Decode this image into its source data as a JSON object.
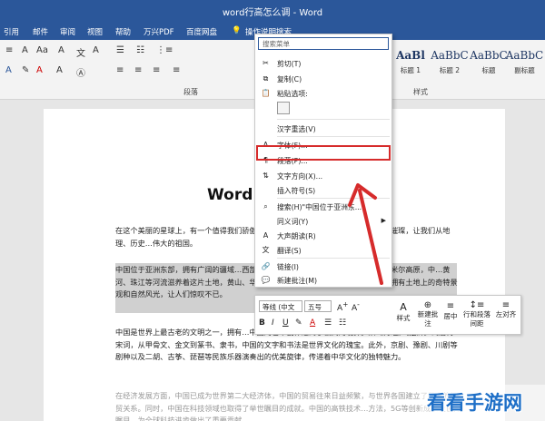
{
  "window": {
    "title": "word行高怎么调 - Word"
  },
  "menu": [
    "引用",
    "邮件",
    "审阅",
    "视图",
    "帮助",
    "万兴PDF",
    "百度网盘",
    "操作说明搜索"
  ],
  "ribbon": {
    "paragraph_group": "段落",
    "styles_group": "样式",
    "styles": [
      {
        "preview": "AaBl",
        "label": "标题 1"
      },
      {
        "preview": "AaBbC",
        "label": "标题 2"
      },
      {
        "preview": "AaBbC",
        "label": "标题"
      },
      {
        "preview": "AaBbC",
        "label": "副标题"
      }
    ]
  },
  "context_menu": {
    "search_placeholder": "搜索菜单",
    "items": [
      {
        "label": "剪切(T)",
        "icon": "scissors-icon"
      },
      {
        "label": "复制(C)",
        "icon": "copy-icon"
      },
      {
        "label": "粘贴选项:",
        "icon": "paste-icon"
      },
      {
        "label": "汉字重选(V)",
        "icon": ""
      },
      {
        "label": "字体(F)...",
        "icon": "font-icon"
      },
      {
        "label": "段落(P)...",
        "icon": "paragraph-icon"
      },
      {
        "label": "文字方向(X)...",
        "icon": "text-direction-icon"
      },
      {
        "label": "插入符号(S)",
        "icon": ""
      },
      {
        "label": "搜索(H)\"中国位于亚洲东...\"",
        "icon": "search-icon"
      },
      {
        "label": "同义词(Y)",
        "icon": ""
      },
      {
        "label": "大声朗读(R)",
        "icon": "read-aloud-icon"
      },
      {
        "label": "翻译(S)",
        "icon": "translate-icon"
      },
      {
        "label": "链接(I)",
        "icon": "link-icon"
      },
      {
        "label": "新建批注(M)",
        "icon": "comment-icon"
      }
    ]
  },
  "mini_toolbar": {
    "font": "等线 (中文",
    "size": "五号",
    "buttons": [
      "样式",
      "新建批注",
      "居中",
      "行和段落间距",
      "左对齐"
    ]
  },
  "document": {
    "title": "Word",
    "paragraphs": [
      "在这个美丽的星球上，有一个值得我们骄傲的国家。在这片土地上，山川秀美、文化璀璨，让我们从地理、历史…伟大的祖国。",
      "中国位于亚洲东部，拥有广阔的疆域…西部的曾母暗沙，从东边的海岸线到西部的帕米尔高原，中…黄河、珠江等河流滋养着这片土地，黄山、华山…泰山等山脉勾勒出壮美的地理轮廓，拥有土地上的奇特景观和自然风光，让人们惊叹不已。",
      "中国是世界上最古老的文明之一，拥有…中国的艺术创作达到了极高的境界。从《诗经》《楚辞》到唐诗宋词，从甲骨文、金文到篆书、隶书，中国的文字和书法是世界文化的瑰宝。此外，京剧、豫剧、川剧等剧种以及二胡、古筝、琵琶等民族乐器演奏出的优美旋律，传递着中华文化的独特魅力。",
      "在经济发展方面，中国已成为世界第二大经济体，中国的贸易往来日益频繁，与世界各国建立了紧密的经贸关系。同时，中国在科技领域也取得了举世瞩目的成就。中国的高铁技术…方法，5G等创新成果让世界瞩目，为全球科技进步做出了重要贡献。"
    ]
  },
  "watermark": "看看手游网",
  "colors": {
    "accent": "#2b579a",
    "highlight_border": "#d62b2b",
    "arrow": "#d62b2b"
  }
}
